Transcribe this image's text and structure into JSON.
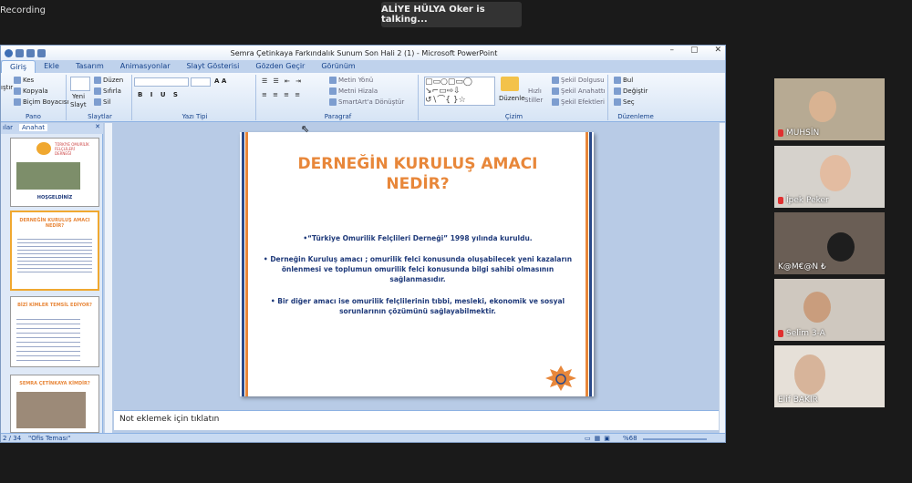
{
  "meeting": {
    "recording_label": "Recording",
    "talking_banner": "ALİYE HÜLYA Oker is talking..."
  },
  "window": {
    "title": "Semra Çetinkaya Farkındalık Sunum Son Hali 2 (1) - Microsoft PowerPoint"
  },
  "ribbon_tabs": [
    "Giriş",
    "Ekle",
    "Tasarım",
    "Animasyonlar",
    "Slayt Gösterisi",
    "Gözden Geçir",
    "Görünüm"
  ],
  "ribbon": {
    "pano": {
      "label": "Pano",
      "kes": "Kes",
      "kopyala": "Kopyala",
      "bicim": "Biçim Boyacısı",
      "paste_short": "ıştır"
    },
    "slaytlar": {
      "label": "Slaytlar",
      "yeni": "Yeni",
      "slayt": "Slayt",
      "duzen": "Düzen",
      "sifirla": "Sıfırla",
      "sil": "Sil"
    },
    "yazi": {
      "label": "Yazı Tipi"
    },
    "paragraf": {
      "label": "Paragraf",
      "metin_yonu": "Metin Yönü",
      "metni_hizala": "Metni Hizala",
      "smartart": "SmartArt'a Dönüştür"
    },
    "cizim": {
      "label": "Çizim",
      "duzenle": "Düzenle",
      "hizli": "Hızlı",
      "stiller": "Stiller",
      "sekil_dolgusu": "Şekil Dolgusu",
      "sekil_anahat": "Şekil Anahattı",
      "sekil_efekt": "Şekil Efektleri"
    },
    "duzenleme": {
      "label": "Düzenleme",
      "bul": "Bul",
      "degistir": "Değiştir",
      "sec": "Seç"
    }
  },
  "panel_tabs": {
    "slaytlar": "ılar",
    "anahat": "Anahat"
  },
  "thumbnails": [
    {
      "title": "TÜRKİYE OMURİLİK FELÇLİLERİ DERNEĞİ",
      "foot": "HOŞGELDİNİZ"
    },
    {
      "title": "DERNEĞİN KURULUŞ AMACI NEDİR?"
    },
    {
      "title": "BİZİ KİMLER TEMSİL EDİYOR?"
    },
    {
      "title": "SEMRA ÇETİNKAYA KİMDİR?"
    }
  ],
  "slide": {
    "title_line1": "DERNEĞİN KURULUŞ AMACI",
    "title_line2": "NEDİR?",
    "bullet1": "•“Türkiye Omurilik Felçlileri Derneği” 1998 yılında kuruldu.",
    "bullet2a": "• Derneğin Kuruluş amacı ; omurilik felci konusunda  oluşabilecek yeni kazaların",
    "bullet2b": "önlenmesi ve toplumun omurilik felci konusunda bilgi sahibi olmasının",
    "bullet2c": "sağlanmasıdır.",
    "bullet3a": "• Bir diğer amacı ise omurilik felçlilerinin tıbbi, mesleki, ekonomik ve sosyal",
    "bullet3b": "sorunlarının çözümünü sağlayabilmektir."
  },
  "notes_placeholder": "Not eklemek için tıklatın",
  "status": {
    "slide_count": "2 / 34",
    "theme": "\"Ofis Teması\"",
    "zoom": "%68"
  },
  "participants": [
    {
      "name": "MUHSİN"
    },
    {
      "name": "İpek Peker"
    },
    {
      "name": "K@M€@N  ₺"
    },
    {
      "name": "Selim  3-A"
    },
    {
      "name": "Elif BAKIR"
    }
  ],
  "colors": {
    "accent_orange": "#e8873a",
    "stripe_blue": "#2a4a8a",
    "bullet_text": "#1f3a7a"
  }
}
